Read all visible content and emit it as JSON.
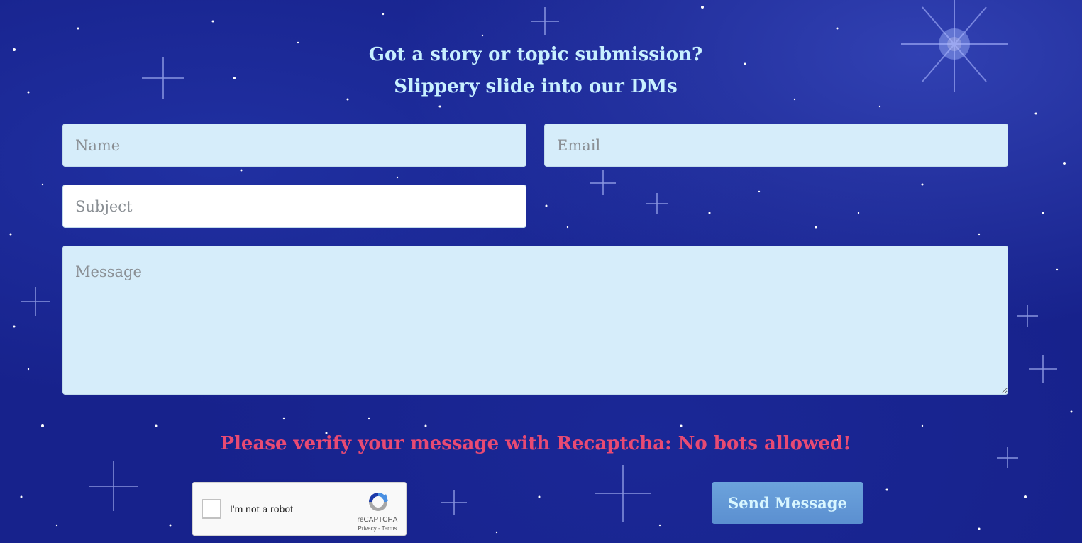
{
  "heading": {
    "line1": "Got a story or topic submission?",
    "line2": "Slippery slide into our DMs"
  },
  "form": {
    "name_placeholder": "Name",
    "email_placeholder": "Email",
    "subject_placeholder": "Subject",
    "message_placeholder": "Message",
    "verify_text": "Please verify your message with Recaptcha: No bots allowed!",
    "send_label": "Send Message"
  },
  "recaptcha": {
    "label": "I'm not a robot",
    "brand": "reCAPTCHA",
    "links": "Privacy - Terms"
  },
  "colors": {
    "background": "#1a2590",
    "heading": "#c8f0ff",
    "field": "#d6edfa",
    "verify_text": "#e84a73",
    "button": "#6197d6"
  }
}
